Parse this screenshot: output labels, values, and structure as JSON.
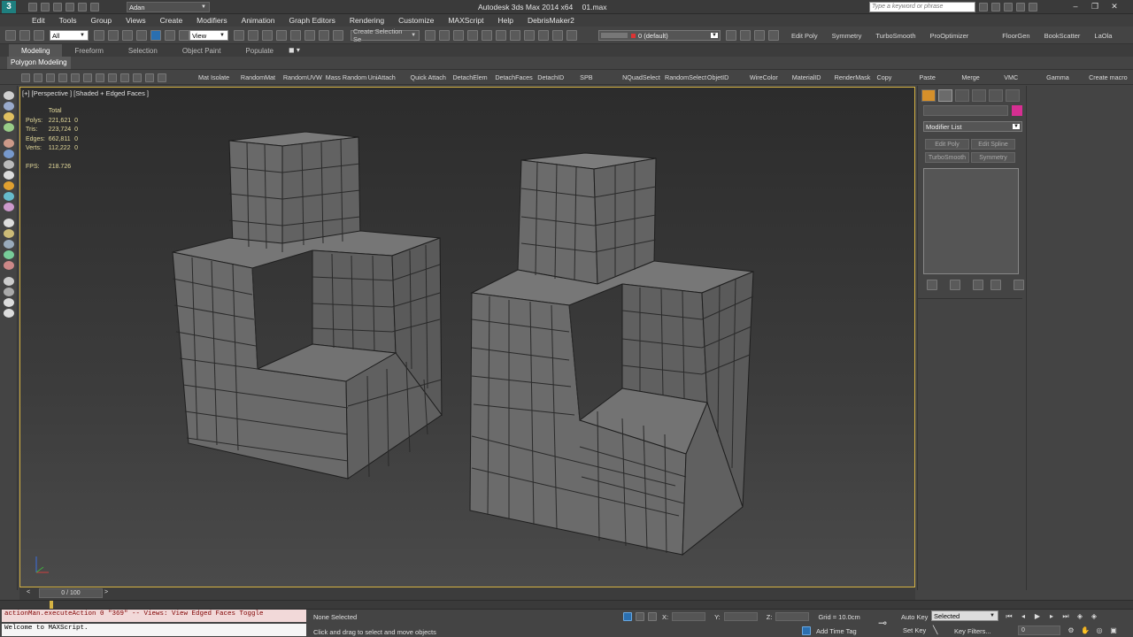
{
  "window": {
    "title": "Autodesk 3ds Max 2014 x64",
    "file": "01.max",
    "workspace": "Adan",
    "search_placeholder": "Type a keyword or phrase",
    "win_buttons": [
      "–",
      "❐",
      "✕"
    ]
  },
  "menu": [
    "Edit",
    "Tools",
    "Group",
    "Views",
    "Create",
    "Modifiers",
    "Animation",
    "Graph Editors",
    "Rendering",
    "Customize",
    "MAXScript",
    "Help",
    "DebrisMaker2"
  ],
  "toolbar": {
    "filter": "All",
    "ref_coord": "View",
    "selection_set": "Create Selection Se",
    "layer": "0 (default)",
    "quick_buttons": [
      "Edit Poly",
      "Symmetry",
      "TurboSmooth",
      "ProOptimizer",
      "FloorGen",
      "BookScatter",
      "LaOla"
    ]
  },
  "ribbon": {
    "tabs": [
      "Modeling",
      "Freeform",
      "Selection",
      "Object Paint",
      "Populate"
    ],
    "active_tab": "Modeling",
    "sub_label": "Polygon Modeling"
  },
  "scripts": [
    "Mat Isolate",
    "RandomMat",
    "RandomUVW",
    "Mass Random",
    "UniAttach",
    "Quick Attach",
    "DetachElem",
    "DetachFaces",
    "DetachID",
    "SPB",
    "NQuadSelect",
    "RandomSelect",
    "ObjetID",
    "WireColor",
    "MaterialID",
    "RenderMask",
    "Copy",
    "Paste",
    "Merge",
    "VMC",
    "Gamma",
    "Create macro"
  ],
  "viewport": {
    "label": "[+] [Perspective ] [Shaded + Edged Faces ]",
    "stats": {
      "header": "Total",
      "rows": [
        {
          "k": "Polys:",
          "v": "221,621",
          "s": "0"
        },
        {
          "k": "Tris:",
          "v": "223,724",
          "s": "0"
        },
        {
          "k": "Edges:",
          "v": "662,811",
          "s": "0"
        },
        {
          "k": "Verts:",
          "v": "112,222",
          "s": "0"
        }
      ],
      "fps_label": "FPS:",
      "fps_value": "218.726"
    }
  },
  "command_panel": {
    "modifier_list": "Modifier List",
    "buttons": [
      "Edit Poly",
      "Edit Spline",
      "TurboSmooth",
      "Symmetry"
    ],
    "name_color": "#d62f92"
  },
  "timeline": {
    "frame": "0 / 100",
    "prev": "<",
    "next": ">"
  },
  "status": {
    "maxscript_line1": "actionMan.executeAction 0 \"369\"  -- Views: View Edged Faces Toggle",
    "maxscript_line2": "Welcome to MAXScript.",
    "selection": "None Selected",
    "prompt": "Click and drag to select and move objects",
    "x_label": "X:",
    "y_label": "Y:",
    "z_label": "Z:",
    "grid": "Grid = 10.0cm",
    "add_time_tag": "Add Time Tag",
    "auto_key": "Auto Key",
    "set_key": "Set Key",
    "key_mode": "Selected",
    "key_filters": "Key Filters...",
    "frame_value": "0"
  },
  "colors": {
    "viewport_border": "#d6b343",
    "stats_text": "#e3d99a",
    "accent_blue": "#2a6fb0"
  }
}
